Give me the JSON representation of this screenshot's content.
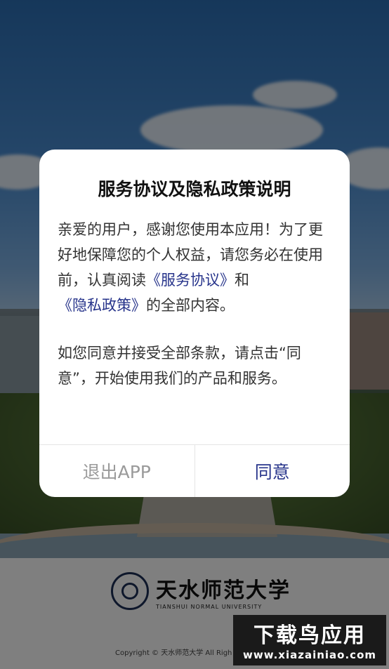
{
  "dialog": {
    "title": "服务协议及隐私政策说明",
    "para1_prefix": "亲爱的用户，感谢您使用本应用！为了更好地保障您的个人权益，请您务必在使用前，认真阅读",
    "service_link": "《服务协议》",
    "para1_and": "和",
    "privacy_link": "《隐私政策》",
    "para1_suffix": "的全部内容。",
    "para2": "如您同意并接受全部条款，请点击“同意”，开始使用我们的产品和服务。",
    "exit_label": "退出APP",
    "agree_label": "同意"
  },
  "footer": {
    "logo_cn": "天水师范大学",
    "logo_en": "TIANSHUI NORMAL UNIVERSITY",
    "copyright": "Copyright © 天水师范大学 All Righ"
  },
  "watermark": {
    "title": "下载鸟应用",
    "url": "www.xiazainiao.com"
  },
  "colors": {
    "link": "#27348b",
    "exit_text": "#9a9a9a",
    "overlay": "rgba(0,0,0,0.5)"
  }
}
